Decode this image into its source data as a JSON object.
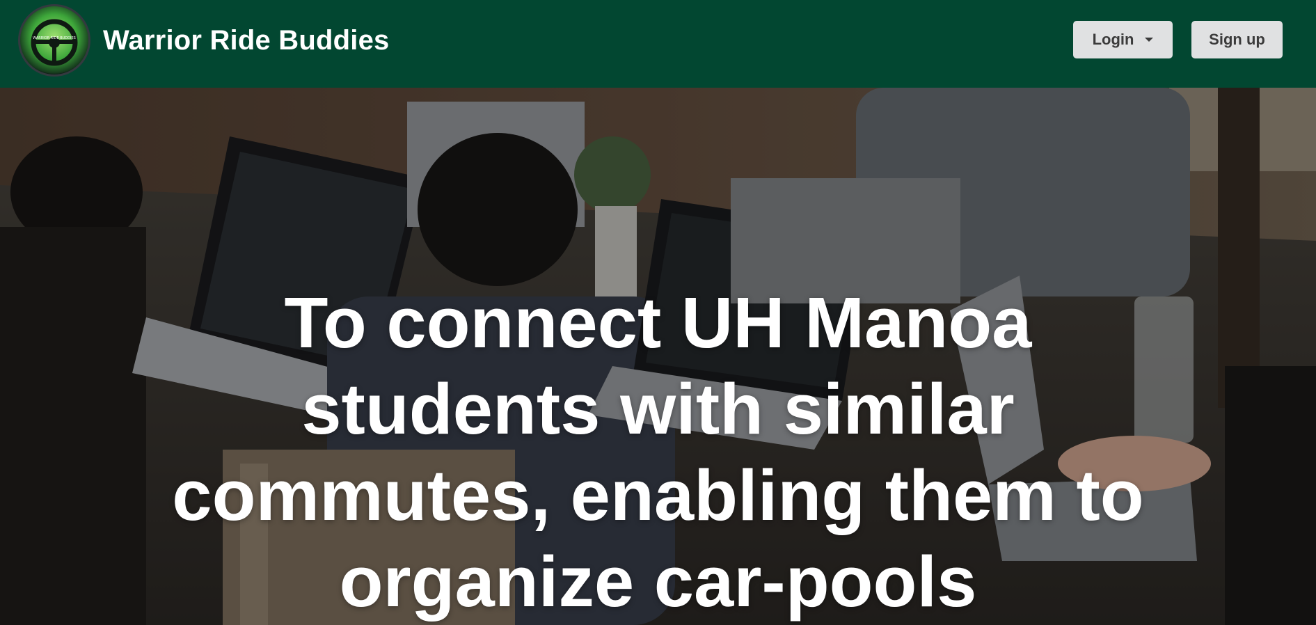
{
  "brand": {
    "logo_text": "WARRIOR RIDE BUDDIES",
    "name": "Warrior Ride Buddies"
  },
  "nav": {
    "login_label": "Login",
    "signup_label": "Sign up"
  },
  "hero": {
    "mission_lines": [
      "To connect UH Manoa",
      "students with similar",
      "commutes, enabling them to",
      "organize car-pools"
    ]
  },
  "colors": {
    "navbar": "#024731",
    "button": "#e0e1e2",
    "hero_text": "#ffffff"
  },
  "icons": {
    "logo": "steering-wheel-logo-icon",
    "login_caret": "caret-down-icon"
  }
}
